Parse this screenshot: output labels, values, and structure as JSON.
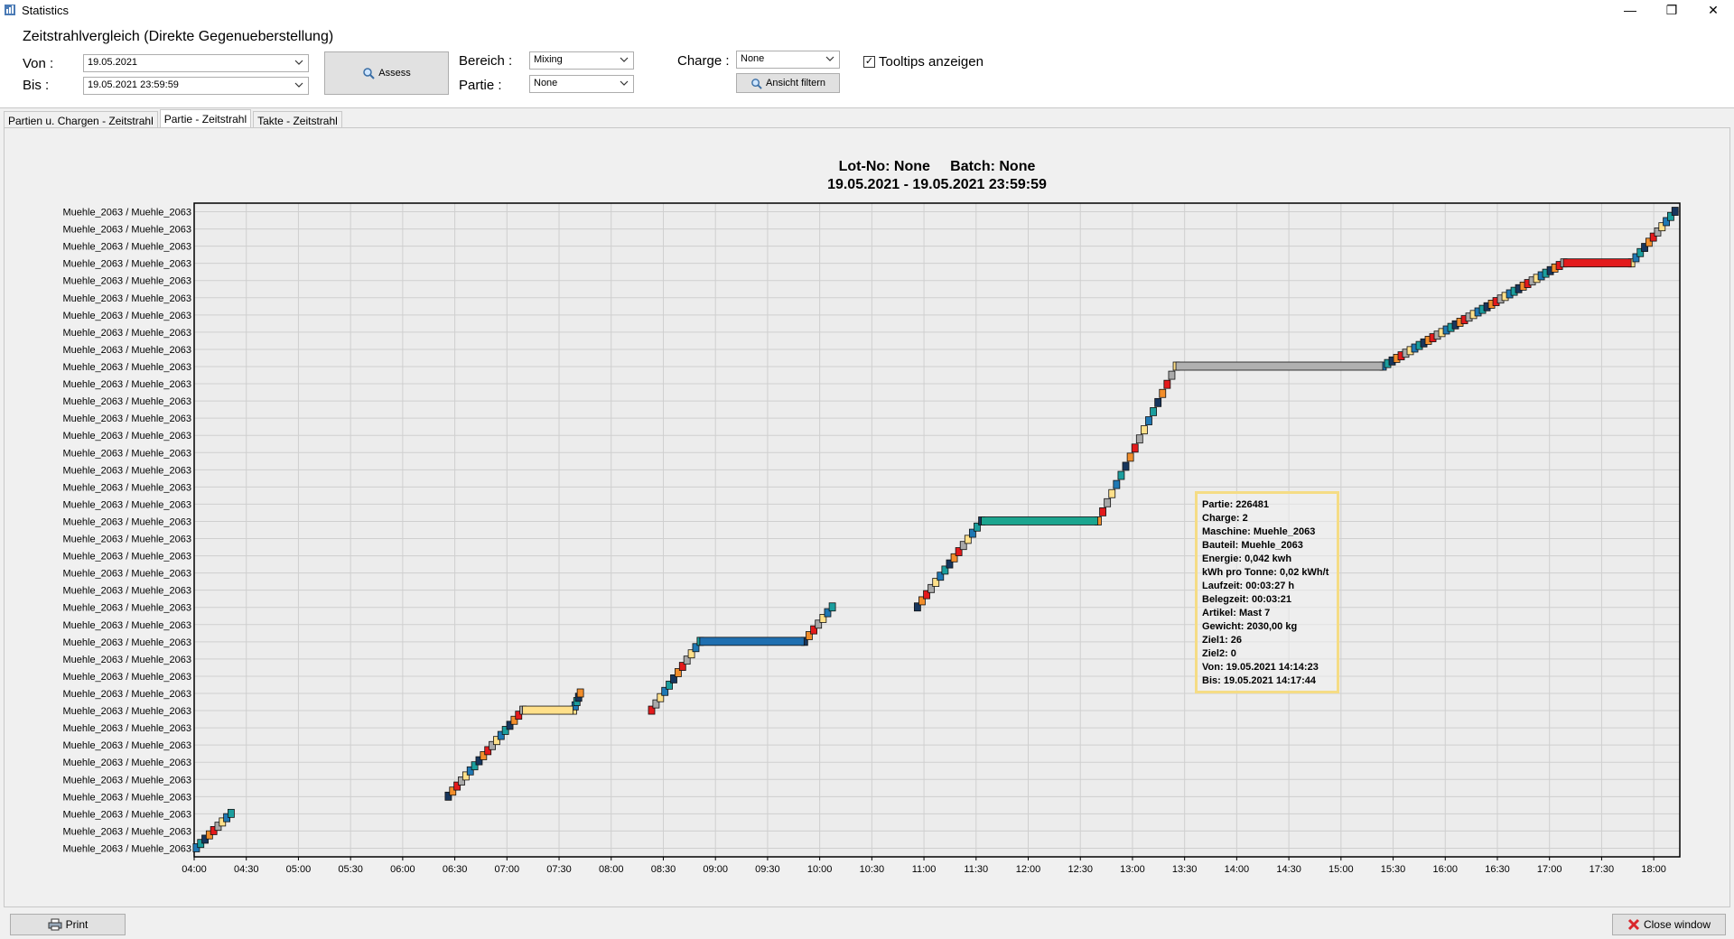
{
  "window": {
    "title": "Statistics",
    "minimize": "—",
    "restore": "❐",
    "close": "✕"
  },
  "header": {
    "title": "Zeitstrahlvergleich (Direkte Gegenueberstellung)",
    "von_label": "Von :",
    "von_value": "19.05.2021",
    "bis_label": "Bis :",
    "bis_value": "19.05.2021 23:59:59",
    "assess_label": "Assess",
    "bereich_label": "Bereich :",
    "bereich_value": "Mixing",
    "partie_label": "Partie :",
    "partie_value": "None",
    "charge_label": "Charge :",
    "charge_value": "None",
    "ansicht_label": "Ansicht filtern",
    "tooltips_label": "Tooltips anzeigen",
    "tooltips_checked": true
  },
  "tabs": [
    {
      "label": "Partien u. Chargen - Zeitstrahl",
      "active": false
    },
    {
      "label": "Partie - Zeitstrahl",
      "active": true
    },
    {
      "label": "Takte - Zeitstrahl",
      "active": false
    }
  ],
  "footer": {
    "print_label": "Print",
    "close_label": "Close window"
  },
  "tooltip": {
    "lines": [
      "Partie: 226481",
      "Charge: 2",
      "Maschine: Muehle_2063",
      "Bauteil: Muehle_2063",
      "Energie: 0,042 kwh",
      "kWh pro Tonne: 0,02 kWh/t",
      "Laufzeit: 00:03:27 h",
      "Belegzeit: 00:03:21",
      "Artikel: Mast 7",
      "Gewicht: 2030,00 kg",
      "Ziel1: 26",
      "Ziel2: 0",
      "Von: 19.05.2021 14:14:23",
      "Bis: 19.05.2021 14:17:44"
    ]
  },
  "chart_data": {
    "type": "gantt",
    "title": "Lot-No: None     Batch: None",
    "subtitle": "19.05.2021 - 19.05.2021 23:59:59",
    "row_label": "Muehle_2063 / Muehle_2063",
    "row_count": 38,
    "x_ticks": [
      "04:00",
      "04:30",
      "05:00",
      "05:30",
      "06:00",
      "06:30",
      "07:00",
      "07:30",
      "08:00",
      "08:30",
      "09:00",
      "09:30",
      "10:00",
      "10:30",
      "11:00",
      "11:30",
      "12:00",
      "12:30",
      "13:00",
      "13:30",
      "14:00",
      "14:30",
      "15:00",
      "15:30",
      "16:00",
      "16:30",
      "17:00",
      "17:30",
      "18:00"
    ],
    "x_range_minutes": [
      240,
      1095
    ],
    "grid": true,
    "palette": [
      "#1f78b4",
      "#1b9e9e",
      "#17365d",
      "#f28e2b",
      "#e31a1c",
      "#a9a9a9",
      "#ffe08a"
    ],
    "long_bars": [
      {
        "start": 429,
        "end": 458,
        "row": 8,
        "color": "#ffe08a"
      },
      {
        "start": 531,
        "end": 591,
        "row": 12,
        "color": "#1f6fb0"
      },
      {
        "start": 693,
        "end": 760,
        "row": 19,
        "color": "#1ba58f"
      },
      {
        "start": 805,
        "end": 924,
        "row": 28,
        "color": "#b0b0b0"
      },
      {
        "start": 1028,
        "end": 1067,
        "row": 34,
        "color": "#e31a1c"
      }
    ],
    "step_runs": [
      {
        "start": 241,
        "end": 261,
        "row_start": 0,
        "row_end": 2
      },
      {
        "start": 386,
        "end": 429,
        "row_start": 3,
        "row_end": 8
      },
      {
        "start": 458,
        "end": 462,
        "row_start": 8,
        "row_end": 9
      },
      {
        "start": 503,
        "end": 531,
        "row_start": 8,
        "row_end": 12
      },
      {
        "start": 591,
        "end": 607,
        "row_start": 12,
        "row_end": 14
      },
      {
        "start": 656,
        "end": 693,
        "row_start": 14,
        "row_end": 19
      },
      {
        "start": 760,
        "end": 805,
        "row_start": 19,
        "row_end": 28
      },
      {
        "start": 924,
        "end": 1028,
        "row_start": 28,
        "row_end": 34
      },
      {
        "start": 1067,
        "end": 1092,
        "row_start": 34,
        "row_end": 37
      }
    ]
  }
}
